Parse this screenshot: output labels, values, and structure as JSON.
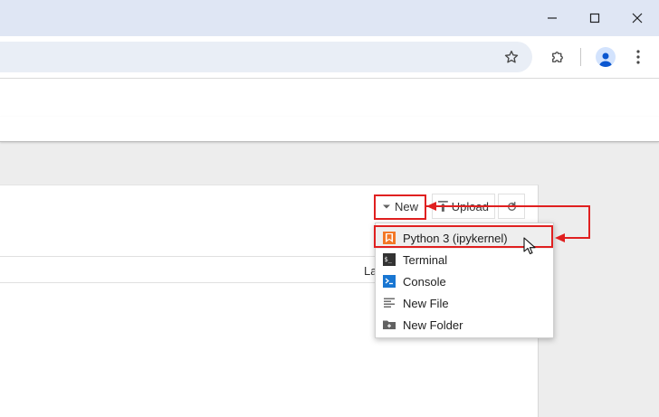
{
  "window": {
    "minimize_glyph": "—",
    "maximize_glyph": "☐",
    "close_glyph": "✕"
  },
  "toolbar": {
    "bookmark_icon": "star-icon",
    "extensions_icon": "puzzle-icon",
    "profile_icon": "avatar-icon",
    "menu_icon": "kebab-icon"
  },
  "file_browser": {
    "buttons": {
      "new_label": "New",
      "upload_label": "Upload",
      "refresh_icon": "refresh-icon"
    },
    "column_header_partial": "La"
  },
  "new_menu": {
    "items": [
      {
        "label": "Python 3 (ipykernel)",
        "icon": "python-kernel-icon",
        "color": "#f37726"
      },
      {
        "label": "Terminal",
        "icon": "terminal-icon",
        "color": "#333333"
      },
      {
        "label": "Console",
        "icon": "console-icon",
        "color": "#1976d2"
      },
      {
        "label": "New File",
        "icon": "text-file-icon",
        "color": "#616161"
      },
      {
        "label": "New Folder",
        "icon": "new-folder-icon",
        "color": "#616161"
      }
    ]
  },
  "colors": {
    "highlight": "#e02020",
    "titlebar": "#dfe6f4",
    "omnibox": "#e9eef6"
  }
}
